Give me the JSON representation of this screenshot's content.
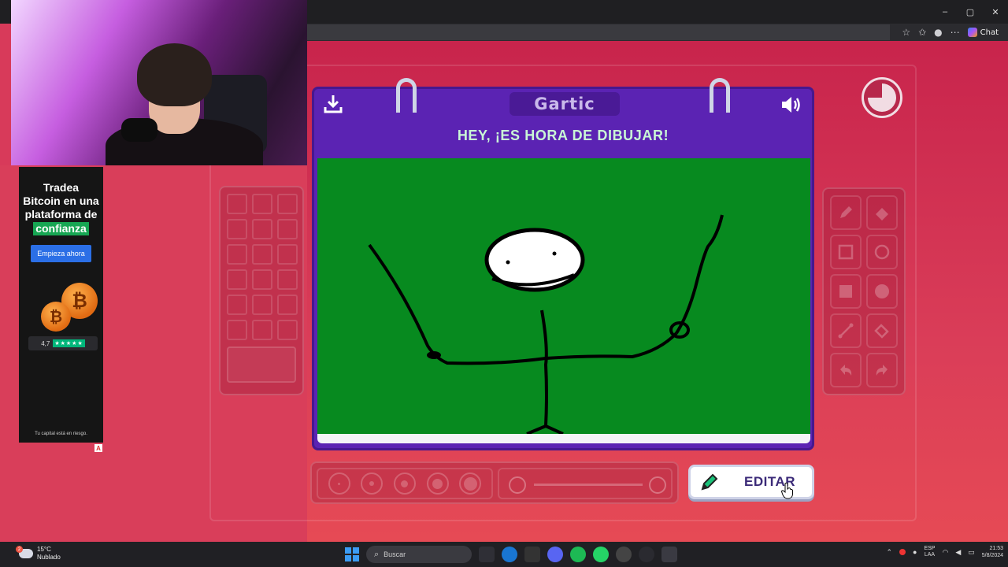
{
  "browser": {
    "controls": [
      "–",
      "▢",
      "✕"
    ],
    "icons": [
      "star-icon",
      "favorites-icon",
      "profile-icon",
      "more-icon"
    ],
    "chat_label": "Chat"
  },
  "ad": {
    "line1": "Tradea",
    "line2": "Bitcoin en una",
    "line3": "plataforma de",
    "highlight": "confianza",
    "button": "Empieza ahora",
    "rating": "4,7",
    "stars": "★★★★★",
    "disclaimer": "Tu capital está en riesgo.",
    "badge": "A"
  },
  "game": {
    "logo": "Gartic",
    "title": "HEY, ¡ES HORA DE DIBUJAR!",
    "edit_button": "EDITAR",
    "colors": {
      "notebook": "#5b23b3",
      "canvas": "#078a1f",
      "title_text": "#c9f7d6"
    }
  },
  "taskbar": {
    "temperature": "15°C",
    "weather": "Nublado",
    "weather_badge": "2",
    "search_placeholder": "Buscar",
    "lang_top": "ESP",
    "lang_bottom": "LAA",
    "time": "21:53",
    "date": "5/8/2024"
  }
}
